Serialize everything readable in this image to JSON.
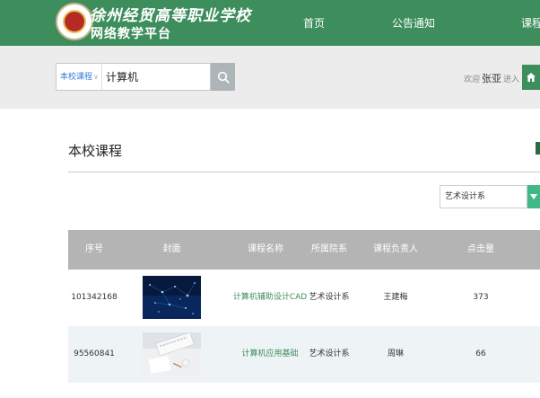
{
  "header": {
    "logo_title": "徐州经贸高等职业学校",
    "logo_subtitle": "网络教学平台",
    "nav": [
      "首页",
      "公告通知",
      "课程中心"
    ]
  },
  "search": {
    "scope": "本校课程",
    "value": "计算机"
  },
  "user_bar": {
    "welcome": "欢迎",
    "username": "张亚",
    "enter": "进入"
  },
  "section": {
    "title": "本校课程",
    "department_filter": "艺术设计系"
  },
  "table": {
    "columns": [
      "序号",
      "封面",
      "课程名称",
      "所属院系",
      "课程负责人",
      "点击量"
    ],
    "rows": [
      {
        "id": "101342168",
        "name": "计算机辅助设计CAD",
        "dept": "艺术设计系",
        "owner": "王建梅",
        "clicks": "373",
        "cover": "blue-network-image"
      },
      {
        "id": "95560841",
        "name": "计算机应用基础",
        "dept": "艺术设计系",
        "owner": "周琳",
        "clicks": "66",
        "cover": "desk-keyboard-image"
      }
    ]
  },
  "colors": {
    "brand_green": "#3d8e5c",
    "accent_teal": "#3fba86",
    "table_header": "#b4b4b4"
  }
}
